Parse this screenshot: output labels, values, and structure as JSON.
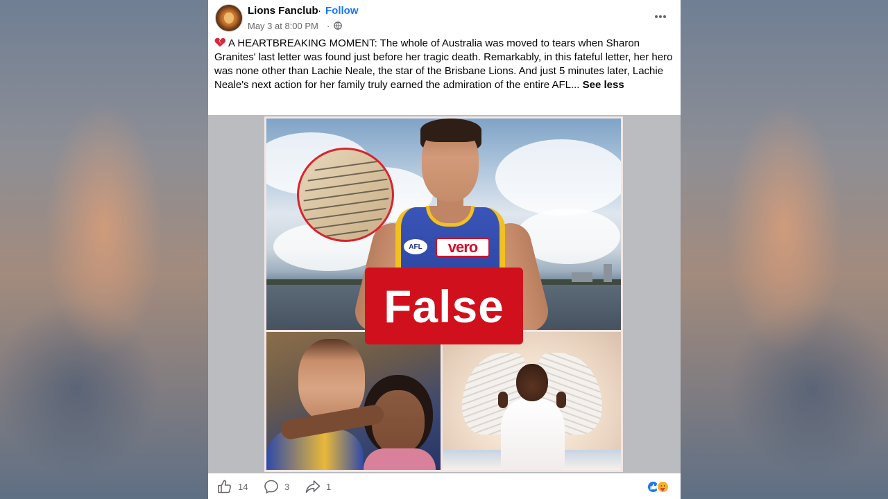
{
  "post": {
    "page_name": "Lions Fanclub",
    "separator": "·",
    "follow_label": "Follow",
    "timestamp": "May 3 at 8:00 PM",
    "time_separator": "·",
    "privacy_icon": "globe-icon",
    "more_icon": "more-horizontal-icon",
    "emoji_icon": "broken-heart-icon",
    "body_text": "A HEARTBREAKING MOMENT: The whole of Australia was moved to tears when Sharon Granites' last letter was found just before her tragic death. Remarkably, in this fateful letter, her hero was none other than Lachie Neale, the star of the Brisbane Lions. And just 5 minutes later, Lachie Neale's next action for her family truly earned the admiration of the entire AFL...",
    "see_less_label": "See less"
  },
  "media": {
    "stamp_label": "False",
    "stamp_color": "#d1101e",
    "jersey_afl": "AFL",
    "jersey_sponsor": "vero"
  },
  "footer": {
    "like_icon": "thumbs-up-icon",
    "like_count": "14",
    "comment_icon": "comment-icon",
    "comment_count": "3",
    "share_icon": "share-icon",
    "share_count": "1",
    "reaction_icons": [
      "like-reaction-icon",
      "care-reaction-icon"
    ]
  },
  "colors": {
    "link_blue": "#1877f2",
    "text_primary": "#050505",
    "text_secondary": "#65676b"
  }
}
